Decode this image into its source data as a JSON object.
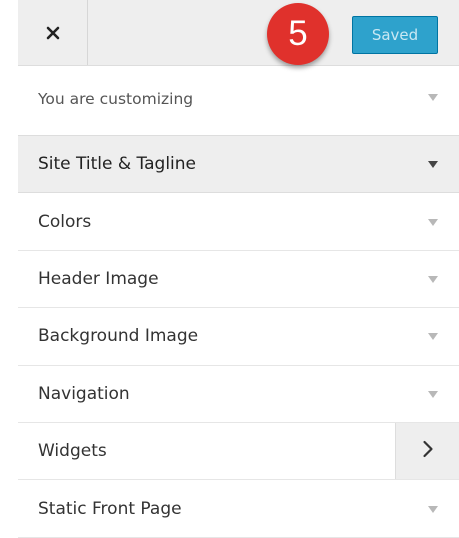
{
  "header": {
    "close_icon": "close-icon",
    "step_badge": "5",
    "saved_label": "Saved"
  },
  "info": {
    "label": "You are customizing"
  },
  "sections": [
    {
      "label": "Site Title & Tagline",
      "active": true
    },
    {
      "label": "Colors"
    },
    {
      "label": "Header Image"
    },
    {
      "label": "Background Image"
    },
    {
      "label": "Navigation"
    },
    {
      "label": "Widgets",
      "icon": "chevron-right-icon"
    },
    {
      "label": "Static Front Page"
    }
  ],
  "colors": {
    "accent": "#2ea2cc",
    "badge": "#e0312c",
    "panel_bg": "#eeeeee"
  }
}
